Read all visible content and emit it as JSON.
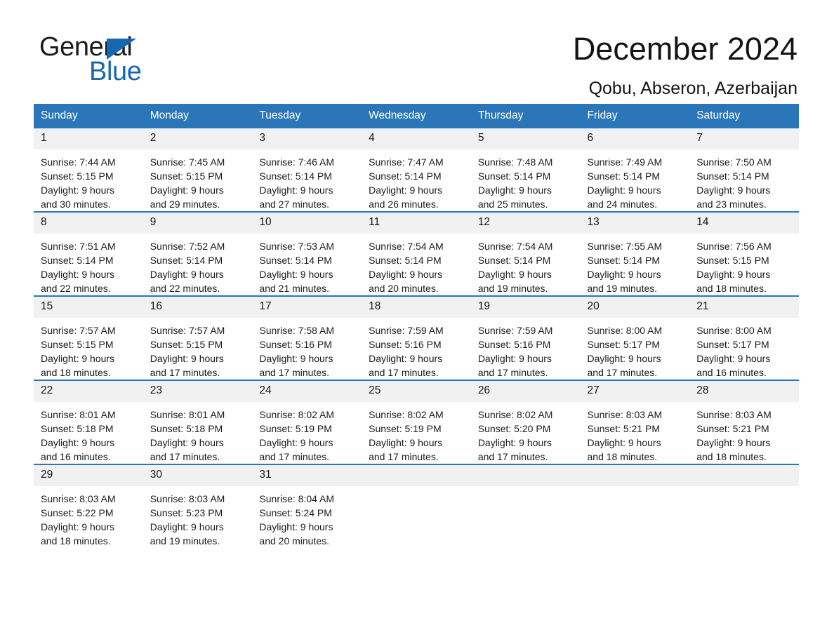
{
  "brand": {
    "name_part1": "General",
    "name_part2": "Blue",
    "triangle_color": "#1567b2"
  },
  "header": {
    "title": "December 2024",
    "subtitle": "Qobu, Abseron, Azerbaijan"
  },
  "theme": {
    "header_bg": "#2b76b9",
    "daynum_bg": "#f1f1f1",
    "row_divider": "#2b76b9",
    "text": "#1b1b1b"
  },
  "weekday_headers": [
    "Sunday",
    "Monday",
    "Tuesday",
    "Wednesday",
    "Thursday",
    "Friday",
    "Saturday"
  ],
  "weeks": [
    [
      {
        "day": "1",
        "sunrise": "Sunrise: 7:44 AM",
        "sunset": "Sunset: 5:15 PM",
        "daylight1": "Daylight: 9 hours",
        "daylight2": "and 30 minutes."
      },
      {
        "day": "2",
        "sunrise": "Sunrise: 7:45 AM",
        "sunset": "Sunset: 5:15 PM",
        "daylight1": "Daylight: 9 hours",
        "daylight2": "and 29 minutes."
      },
      {
        "day": "3",
        "sunrise": "Sunrise: 7:46 AM",
        "sunset": "Sunset: 5:14 PM",
        "daylight1": "Daylight: 9 hours",
        "daylight2": "and 27 minutes."
      },
      {
        "day": "4",
        "sunrise": "Sunrise: 7:47 AM",
        "sunset": "Sunset: 5:14 PM",
        "daylight1": "Daylight: 9 hours",
        "daylight2": "and 26 minutes."
      },
      {
        "day": "5",
        "sunrise": "Sunrise: 7:48 AM",
        "sunset": "Sunset: 5:14 PM",
        "daylight1": "Daylight: 9 hours",
        "daylight2": "and 25 minutes."
      },
      {
        "day": "6",
        "sunrise": "Sunrise: 7:49 AM",
        "sunset": "Sunset: 5:14 PM",
        "daylight1": "Daylight: 9 hours",
        "daylight2": "and 24 minutes."
      },
      {
        "day": "7",
        "sunrise": "Sunrise: 7:50 AM",
        "sunset": "Sunset: 5:14 PM",
        "daylight1": "Daylight: 9 hours",
        "daylight2": "and 23 minutes."
      }
    ],
    [
      {
        "day": "8",
        "sunrise": "Sunrise: 7:51 AM",
        "sunset": "Sunset: 5:14 PM",
        "daylight1": "Daylight: 9 hours",
        "daylight2": "and 22 minutes."
      },
      {
        "day": "9",
        "sunrise": "Sunrise: 7:52 AM",
        "sunset": "Sunset: 5:14 PM",
        "daylight1": "Daylight: 9 hours",
        "daylight2": "and 22 minutes."
      },
      {
        "day": "10",
        "sunrise": "Sunrise: 7:53 AM",
        "sunset": "Sunset: 5:14 PM",
        "daylight1": "Daylight: 9 hours",
        "daylight2": "and 21 minutes."
      },
      {
        "day": "11",
        "sunrise": "Sunrise: 7:54 AM",
        "sunset": "Sunset: 5:14 PM",
        "daylight1": "Daylight: 9 hours",
        "daylight2": "and 20 minutes."
      },
      {
        "day": "12",
        "sunrise": "Sunrise: 7:54 AM",
        "sunset": "Sunset: 5:14 PM",
        "daylight1": "Daylight: 9 hours",
        "daylight2": "and 19 minutes."
      },
      {
        "day": "13",
        "sunrise": "Sunrise: 7:55 AM",
        "sunset": "Sunset: 5:14 PM",
        "daylight1": "Daylight: 9 hours",
        "daylight2": "and 19 minutes."
      },
      {
        "day": "14",
        "sunrise": "Sunrise: 7:56 AM",
        "sunset": "Sunset: 5:15 PM",
        "daylight1": "Daylight: 9 hours",
        "daylight2": "and 18 minutes."
      }
    ],
    [
      {
        "day": "15",
        "sunrise": "Sunrise: 7:57 AM",
        "sunset": "Sunset: 5:15 PM",
        "daylight1": "Daylight: 9 hours",
        "daylight2": "and 18 minutes."
      },
      {
        "day": "16",
        "sunrise": "Sunrise: 7:57 AM",
        "sunset": "Sunset: 5:15 PM",
        "daylight1": "Daylight: 9 hours",
        "daylight2": "and 17 minutes."
      },
      {
        "day": "17",
        "sunrise": "Sunrise: 7:58 AM",
        "sunset": "Sunset: 5:16 PM",
        "daylight1": "Daylight: 9 hours",
        "daylight2": "and 17 minutes."
      },
      {
        "day": "18",
        "sunrise": "Sunrise: 7:59 AM",
        "sunset": "Sunset: 5:16 PM",
        "daylight1": "Daylight: 9 hours",
        "daylight2": "and 17 minutes."
      },
      {
        "day": "19",
        "sunrise": "Sunrise: 7:59 AM",
        "sunset": "Sunset: 5:16 PM",
        "daylight1": "Daylight: 9 hours",
        "daylight2": "and 17 minutes."
      },
      {
        "day": "20",
        "sunrise": "Sunrise: 8:00 AM",
        "sunset": "Sunset: 5:17 PM",
        "daylight1": "Daylight: 9 hours",
        "daylight2": "and 17 minutes."
      },
      {
        "day": "21",
        "sunrise": "Sunrise: 8:00 AM",
        "sunset": "Sunset: 5:17 PM",
        "daylight1": "Daylight: 9 hours",
        "daylight2": "and 16 minutes."
      }
    ],
    [
      {
        "day": "22",
        "sunrise": "Sunrise: 8:01 AM",
        "sunset": "Sunset: 5:18 PM",
        "daylight1": "Daylight: 9 hours",
        "daylight2": "and 16 minutes."
      },
      {
        "day": "23",
        "sunrise": "Sunrise: 8:01 AM",
        "sunset": "Sunset: 5:18 PM",
        "daylight1": "Daylight: 9 hours",
        "daylight2": "and 17 minutes."
      },
      {
        "day": "24",
        "sunrise": "Sunrise: 8:02 AM",
        "sunset": "Sunset: 5:19 PM",
        "daylight1": "Daylight: 9 hours",
        "daylight2": "and 17 minutes."
      },
      {
        "day": "25",
        "sunrise": "Sunrise: 8:02 AM",
        "sunset": "Sunset: 5:19 PM",
        "daylight1": "Daylight: 9 hours",
        "daylight2": "and 17 minutes."
      },
      {
        "day": "26",
        "sunrise": "Sunrise: 8:02 AM",
        "sunset": "Sunset: 5:20 PM",
        "daylight1": "Daylight: 9 hours",
        "daylight2": "and 17 minutes."
      },
      {
        "day": "27",
        "sunrise": "Sunrise: 8:03 AM",
        "sunset": "Sunset: 5:21 PM",
        "daylight1": "Daylight: 9 hours",
        "daylight2": "and 18 minutes."
      },
      {
        "day": "28",
        "sunrise": "Sunrise: 8:03 AM",
        "sunset": "Sunset: 5:21 PM",
        "daylight1": "Daylight: 9 hours",
        "daylight2": "and 18 minutes."
      }
    ],
    [
      {
        "day": "29",
        "sunrise": "Sunrise: 8:03 AM",
        "sunset": "Sunset: 5:22 PM",
        "daylight1": "Daylight: 9 hours",
        "daylight2": "and 18 minutes."
      },
      {
        "day": "30",
        "sunrise": "Sunrise: 8:03 AM",
        "sunset": "Sunset: 5:23 PM",
        "daylight1": "Daylight: 9 hours",
        "daylight2": "and 19 minutes."
      },
      {
        "day": "31",
        "sunrise": "Sunrise: 8:04 AM",
        "sunset": "Sunset: 5:24 PM",
        "daylight1": "Daylight: 9 hours",
        "daylight2": "and 20 minutes."
      },
      {
        "day": "",
        "sunrise": "",
        "sunset": "",
        "daylight1": "",
        "daylight2": ""
      },
      {
        "day": "",
        "sunrise": "",
        "sunset": "",
        "daylight1": "",
        "daylight2": ""
      },
      {
        "day": "",
        "sunrise": "",
        "sunset": "",
        "daylight1": "",
        "daylight2": ""
      },
      {
        "day": "",
        "sunrise": "",
        "sunset": "",
        "daylight1": "",
        "daylight2": ""
      }
    ]
  ]
}
